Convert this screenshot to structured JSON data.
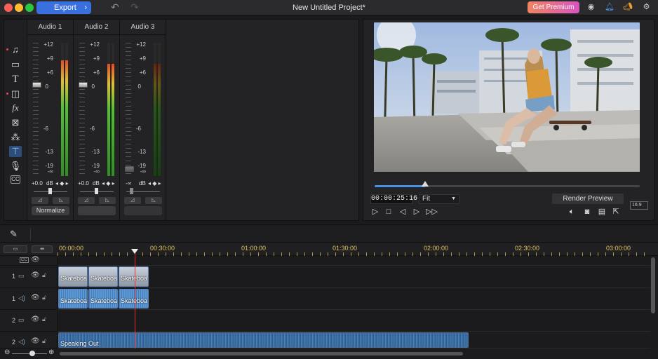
{
  "window": {
    "title": "New Untitled Project*"
  },
  "toolbar": {
    "export_label": "Export",
    "premium_label": "Get Premium",
    "colors": {
      "export": "#3a6fe0",
      "premium_start": "#f08560",
      "premium_end": "#d955c0"
    }
  },
  "mixer": {
    "channels": [
      {
        "name": "Audio 1",
        "value": "+0.0",
        "unit": "dB",
        "button": "Normalize",
        "level": 0.87
      },
      {
        "name": "Audio 2",
        "value": "+0.0",
        "unit": "dB",
        "button": "",
        "level": 0.84
      },
      {
        "name": "Audio 3",
        "value": "-∞",
        "unit": "dB",
        "button": "",
        "level": 0.84
      }
    ],
    "scale": [
      "+12",
      "+9",
      "+6",
      "0",
      "-6",
      "-13",
      "-19",
      "-∞"
    ]
  },
  "preview": {
    "timecode": "00:00:25:16",
    "fit_label": "Fit",
    "render_label": "Render Preview",
    "aspect_label": "16:9",
    "progress": 0.19
  },
  "timeline": {
    "ruler": [
      "00:00:00",
      "00:30:00",
      "01:00:00",
      "01:30:00",
      "02:00:00",
      "02:30:00",
      "03:00:00"
    ],
    "tracks": [
      {
        "num": "1",
        "type": "video"
      },
      {
        "num": "1",
        "type": "audio"
      },
      {
        "num": "2",
        "type": "video"
      },
      {
        "num": "2",
        "type": "audio"
      }
    ],
    "video_clips": [
      "Skateboa",
      "Skateboa",
      "Skateboa"
    ],
    "audio_clips": [
      "Skateboa",
      "Skateboa",
      "Skateboa"
    ],
    "audio2_clip": "Speaking Out"
  }
}
